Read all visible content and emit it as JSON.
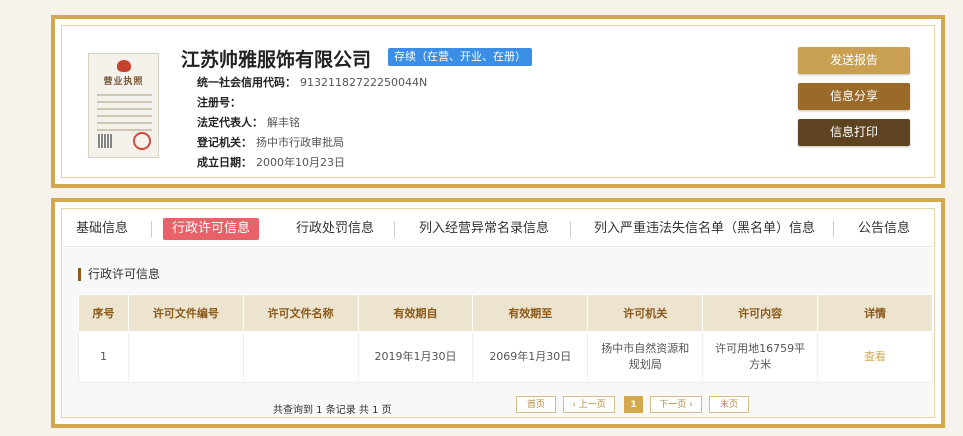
{
  "company": {
    "name": "江苏帅雅服饰有限公司",
    "status": "存续（在营、开业、在册）",
    "license_image": {
      "title": "营业执照"
    },
    "fields": [
      {
        "label": "统一社会信用代码：",
        "value": "91321182722250044N"
      },
      {
        "label": "注册号：",
        "value": ""
      },
      {
        "label": "法定代表人：",
        "value": "解丰铭"
      },
      {
        "label": "登记机关：",
        "value": "扬中市行政审批局"
      },
      {
        "label": "成立日期：",
        "value": "2000年10月23日"
      }
    ]
  },
  "actions": {
    "send_report": "发送报告",
    "share": "信息分享",
    "print": "信息打印"
  },
  "colors": {
    "frame": "#d2a94f",
    "send_report_bg": "#c9a052",
    "share_bg": "#9a6a2a",
    "print_bg": "#5e4320",
    "active_tab": "#e9626a",
    "status_badge": "#3a8ee6"
  },
  "tabs": [
    {
      "label": "基础信息",
      "active": false
    },
    {
      "label": "行政许可信息",
      "active": true
    },
    {
      "label": "行政处罚信息",
      "active": false
    },
    {
      "label": "列入经营异常名录信息",
      "active": false
    },
    {
      "label": "列入严重违法失信名单（黑名单）信息",
      "active": false
    },
    {
      "label": "公告信息",
      "active": false
    }
  ],
  "section": {
    "title": "行政许可信息",
    "columns": [
      "序号",
      "许可文件编号",
      "许可文件名称",
      "有效期自",
      "有效期至",
      "许可机关",
      "许可内容",
      "详情"
    ],
    "rows": [
      [
        "1",
        "",
        "",
        "2019年1月30日",
        "2069年1月30日",
        "扬中市自然资源和规划局",
        "许可用地16759平方米",
        "查看"
      ]
    ]
  },
  "pagination": {
    "summary": "共查询到 1 条记录 共 1 页",
    "first": "首页",
    "prev": "‹ 上一页",
    "current": "1",
    "next": "下一页 ›",
    "last": "末页"
  }
}
